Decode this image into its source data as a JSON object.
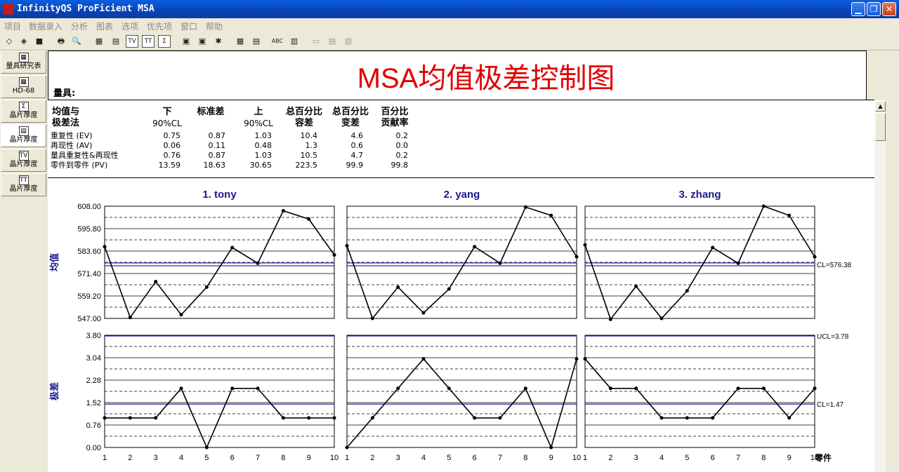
{
  "window": {
    "title": "InfinityQS ProFicient MSA",
    "minimize": "▁",
    "restore": "❐",
    "close": "✕"
  },
  "menu": [
    "项目",
    "数据录入",
    "分析",
    "图表",
    "选项",
    "优先项",
    "窗口",
    "帮助"
  ],
  "toolbar": [
    "◇",
    "◈",
    "■",
    "🖶",
    "🔍",
    "▦",
    "▤",
    "TV",
    "TT",
    "Σ",
    "▣",
    "▣",
    "✱",
    "▦",
    "▤",
    "ABC",
    "▥",
    "▭",
    "▤",
    "▥"
  ],
  "sidebar": [
    {
      "label": "量具研究表",
      "icon": "▦"
    },
    {
      "label": "HD-68",
      "icon": "▦"
    },
    {
      "label": "晶片厚度",
      "icon": "Σ"
    },
    {
      "label": "晶片厚度",
      "icon": "▤"
    },
    {
      "label": "晶片厚度",
      "icon": "TV"
    },
    {
      "label": "晶片厚度",
      "icon": "TT"
    }
  ],
  "report": {
    "title": "MSA均值极差控制图",
    "gauge_label": "量具:"
  },
  "stats": {
    "headers": [
      {
        "l1": "均值与",
        "l2": "极差法"
      },
      {
        "l1": "下",
        "l2": "90%CL"
      },
      {
        "l1": "",
        "l2": "标准差"
      },
      {
        "l1": "上",
        "l2": "90%CL"
      },
      {
        "l1": "总百分比",
        "l2": "容差"
      },
      {
        "l1": "总百分比",
        "l2": "变差"
      },
      {
        "l1": "百分比",
        "l2": "贡献率"
      }
    ],
    "rows": [
      {
        "name": "重复性 (EV)",
        "values": [
          "0.75",
          "0.87",
          "1.03",
          "10.4",
          "4.6",
          "0.2"
        ]
      },
      {
        "name": "再现性 (AV)",
        "values": [
          "0.06",
          "0.11",
          "0.48",
          "1.3",
          "0.6",
          "0.0"
        ]
      },
      {
        "name": "量具重复性&再现性",
        "values": [
          "0.76",
          "0.87",
          "1.03",
          "10.5",
          "4.7",
          "0.2"
        ]
      },
      {
        "name": "零件到零件 (PV)",
        "values": [
          "13.59",
          "18.63",
          "30.65",
          "223.5",
          "99.9",
          "99.8"
        ]
      }
    ]
  },
  "chart_data": {
    "type": "line",
    "panels": [
      "1. tony",
      "2. yang",
      "3. zhang"
    ],
    "x": [
      1,
      2,
      3,
      4,
      5,
      6,
      7,
      8,
      9,
      10
    ],
    "x_axis_label": "零件",
    "mean_chart": {
      "ylabel": "均值",
      "yticks": [
        "608.00",
        "595.80",
        "583.60",
        "571.40",
        "559.20",
        "547.00"
      ],
      "ylim": [
        547.0,
        608.0
      ],
      "cl": 576.38,
      "cl_label": "CL=576.38",
      "series": [
        {
          "values": [
            586.0,
            547.5,
            567.0,
            549.0,
            564.0,
            585.5,
            577.0,
            605.5,
            601.0,
            581.5
          ]
        },
        {
          "values": [
            586.5,
            547.0,
            564.0,
            550.0,
            563.0,
            586.0,
            577.0,
            607.5,
            603.0,
            580.5
          ]
        },
        {
          "values": [
            587.0,
            546.5,
            564.5,
            547.0,
            562.0,
            585.5,
            577.0,
            608.0,
            603.0,
            580.5
          ]
        }
      ]
    },
    "range_chart": {
      "ylabel": "极差",
      "yticks": [
        "3.80",
        "3.04",
        "2.28",
        "1.52",
        "0.76",
        "0.00"
      ],
      "ylim": [
        0,
        3.8
      ],
      "ucl": 3.78,
      "ucl_label": "UCL=3.78",
      "cl": 1.47,
      "cl_label": "CL=1.47",
      "series": [
        {
          "values": [
            1,
            1,
            1,
            2,
            0,
            2,
            2,
            1,
            1,
            1
          ]
        },
        {
          "values": [
            0,
            1,
            2,
            3,
            2,
            1,
            1,
            2,
            0,
            3
          ]
        },
        {
          "values": [
            3,
            2,
            2,
            1,
            1,
            1,
            2,
            2,
            1,
            2
          ]
        }
      ]
    },
    "colors": {
      "line": "#000000",
      "cl": "#1a1aa0",
      "title": "#1a1a8c"
    }
  }
}
